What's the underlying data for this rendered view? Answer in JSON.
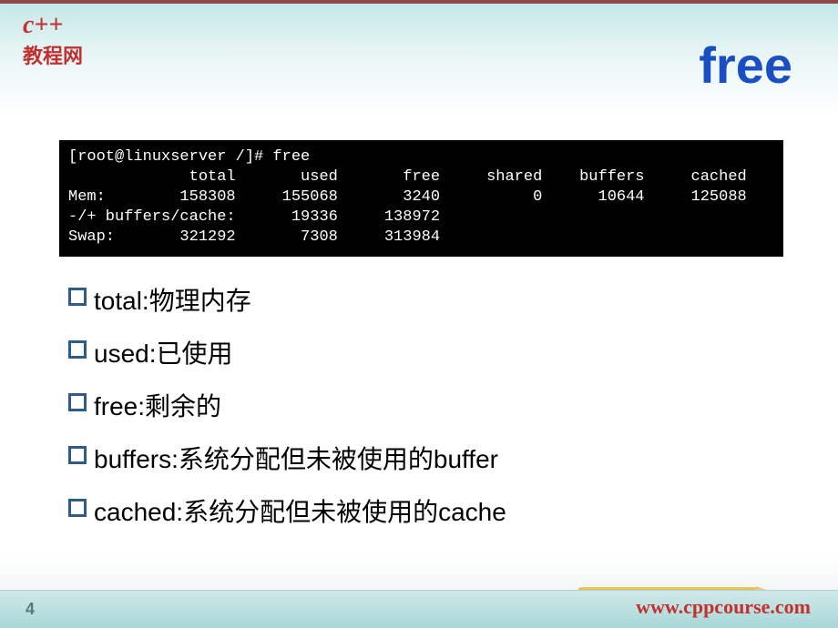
{
  "logo": {
    "cpp": "c++",
    "text": "教程网"
  },
  "title": "free",
  "terminal": {
    "prompt": "[root@linuxserver /]# free",
    "header": "             total       used       free     shared    buffers     cached",
    "mem": "Mem:        158308     155068       3240          0      10644     125088",
    "bc": "-/+ buffers/cache:      19336     138972",
    "swap": "Swap:       321292       7308     313984"
  },
  "bullets": [
    "total:物理内存",
    "used:已使用",
    "free:剩余的",
    "buffers:系统分配但未被使用的buffer",
    "cached:系统分配但未被使用的cache"
  ],
  "footer": {
    "page": "4",
    "url": "www.cppcourse.com"
  }
}
